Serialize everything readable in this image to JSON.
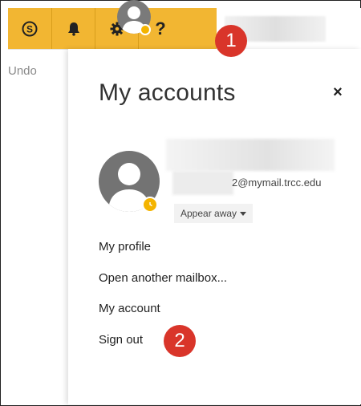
{
  "toolbar": {
    "buttons": [
      {
        "icon": "skype-icon",
        "glyph": "S"
      },
      {
        "icon": "bell-icon"
      },
      {
        "icon": "gear-icon"
      },
      {
        "icon": "help-icon",
        "glyph": "?"
      }
    ],
    "accent_color": "#f2b632"
  },
  "mail": {
    "undo_label": "Undo"
  },
  "accounts_panel": {
    "title": "My accounts",
    "close_glyph": "×",
    "email_suffix": "2@mymail.trcc.edu",
    "presence_label": "Appear away",
    "presence_color": "#f4b400",
    "menu": [
      "My profile",
      "Open another mailbox...",
      "My account",
      "Sign out"
    ]
  },
  "callouts": {
    "one": "1",
    "two": "2",
    "color": "#d9352a"
  }
}
